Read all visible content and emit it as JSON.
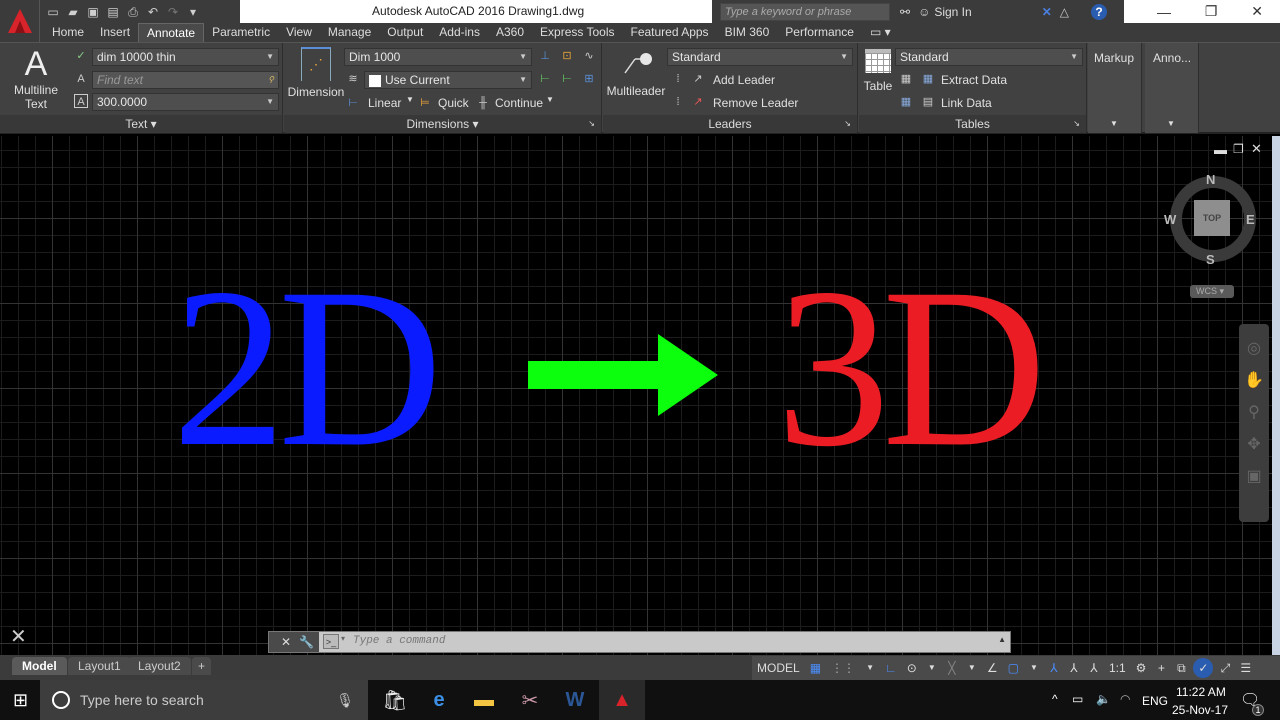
{
  "window": {
    "title": "Autodesk AutoCAD 2016    Drawing1.dwg",
    "search_placeholder": "Type a keyword or phrase",
    "sign_in": "Sign In",
    "help": "?",
    "minimize": "—",
    "maximize": "❐",
    "close": "✕"
  },
  "quick_access": [
    "new-icon",
    "open-icon",
    "save-icon",
    "save-as-icon",
    "plot-icon",
    "undo-icon",
    "redo-icon",
    "customize-icon"
  ],
  "tabs": [
    "Home",
    "Insert",
    "Annotate",
    "Parametric",
    "View",
    "Manage",
    "Output",
    "Add-ins",
    "A360",
    "Express Tools",
    "Featured Apps",
    "BIM 360",
    "Performance"
  ],
  "active_tab": "Annotate",
  "ribbon": {
    "text": {
      "title": "Text ▾",
      "big_button": "Multiline Text",
      "big_line1": "Multiline",
      "big_line2": "Text",
      "style": "dim 10000 thin",
      "find_placeholder": "Find text",
      "height": "300.0000"
    },
    "dimensions": {
      "title": "Dimensions ▾",
      "big_button": "Dimension",
      "style": "Dim 1000",
      "layer": "Use Current",
      "linear": "Linear",
      "quick": "Quick",
      "continue": "Continue"
    },
    "leaders": {
      "title": "Leaders",
      "big_button": "Multileader",
      "style": "Standard",
      "add": "Add Leader",
      "remove": "Remove Leader"
    },
    "tables": {
      "title": "Tables",
      "big_button": "Table",
      "style": "Standard",
      "extract": "Extract Data",
      "link": "Link Data"
    },
    "markup": "Markup",
    "anno": "Anno..."
  },
  "drawing": {
    "left_text": "2D",
    "left_color": "#0a1cff",
    "arrow_color": "#0cff0c",
    "right_text": "3D",
    "right_color": "#ec1c24"
  },
  "viewcube": {
    "n": "N",
    "s": "S",
    "e": "E",
    "w": "W",
    "face": "TOP",
    "ucs": "WCS"
  },
  "command": {
    "placeholder": "Type a command"
  },
  "layout_tabs": [
    "Model",
    "Layout1",
    "Layout2",
    "+"
  ],
  "statusbar": {
    "model": "MODEL",
    "scale": "1:1"
  },
  "taskbar": {
    "search_placeholder": "Type here to search",
    "lang": "ENG",
    "time": "11:22 AM",
    "date": "25-Nov-17",
    "notifications": "1"
  }
}
